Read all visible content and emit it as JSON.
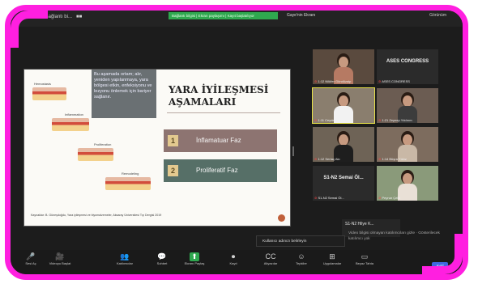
{
  "window": {
    "meeting_title": "Bağlantı bi...",
    "green_banner": "Bağlantı bilgisi | Ekran paylaşımı | Kayıt başlatılıyor",
    "sharer_label": "Gaye'nin Ekranı",
    "view_option": "Görünüm"
  },
  "slide": {
    "callout": "Bu aşamada ortam; alır, yeniden yapılanmaya, yara bölgesi etkin, enfeksiyonu ve lezyonu önlemek için bariyer sağlanır.",
    "title": "YARA İYİLEŞMESİ AŞAMALARI",
    "phases": [
      {
        "num": "1",
        "label": "İnflamatuar Faz"
      },
      {
        "num": "2",
        "label": "Proliferatif Faz"
      }
    ],
    "diagram_labels": [
      "Hemostasis",
      "Inflammation",
      "Proliferation",
      "Remodeling"
    ],
    "footer": "Kaynaklar: B. Güneşdoğdu, Yara iyileşmesi ve biyomalzemeler, Aksaray Üniversitesi Tıp Dergisi 2019"
  },
  "participants": [
    {
      "name": "1:12 Nilüfer Gündüzalp",
      "muted": true,
      "type": "video"
    },
    {
      "name": "ASES CONGRESS",
      "muted": true,
      "type": "text"
    },
    {
      "name": "1:11 Ceyda Aydoğdu",
      "muted": true,
      "type": "video",
      "active": true
    },
    {
      "name": "1:21 Zeynep Yıldırım",
      "muted": true,
      "type": "video"
    },
    {
      "name": "1:12 Sertaç Akı",
      "muted": true,
      "type": "video"
    },
    {
      "name": "1:14 Büşra Yıldız",
      "muted": true,
      "type": "video"
    },
    {
      "name": "S1-N2 Semai Öl...",
      "muted": true,
      "type": "text"
    },
    {
      "name": "Peynar Çelik",
      "muted": true,
      "type": "video"
    }
  ],
  "popup": {
    "name": "S1-N2 Hilye K..."
  },
  "caption_input": {
    "placeholder": "Kullanıcı adınızı belirleyin"
  },
  "hidden_note": "Video bilgisi olmayan katılımcıları gizle · Gösterilecek katılımcı yok",
  "toolbar": {
    "items": [
      {
        "icon": "microphone",
        "label": "Sesi Aç",
        "glyph": "🎤"
      },
      {
        "icon": "video",
        "label": "Videoyu Başlat",
        "glyph": "🎥"
      },
      {
        "icon": "participants",
        "label": "Katılımcılar",
        "glyph": "👥"
      },
      {
        "icon": "chat",
        "label": "Sohbet",
        "glyph": "💬"
      },
      {
        "icon": "share-screen",
        "label": "Ekranı Paylaş",
        "glyph": "⬆"
      },
      {
        "icon": "record",
        "label": "Kayıt",
        "glyph": "⏺"
      },
      {
        "icon": "captions",
        "label": "Altyazılar",
        "glyph": "CC"
      },
      {
        "icon": "reactions",
        "label": "Tepkiler",
        "glyph": "☺"
      },
      {
        "icon": "apps",
        "label": "Uygulamalar",
        "glyph": "⊞"
      },
      {
        "icon": "whiteboard",
        "label": "Beyaz Tahta",
        "glyph": "▭"
      }
    ],
    "end_label": "Ayrıl"
  },
  "colors": {
    "frame": "#ff1fe0",
    "phase1": "#8d7471",
    "phase2": "#566f67",
    "share_green": "#2fa84f",
    "active_outline": "#e7e148"
  }
}
